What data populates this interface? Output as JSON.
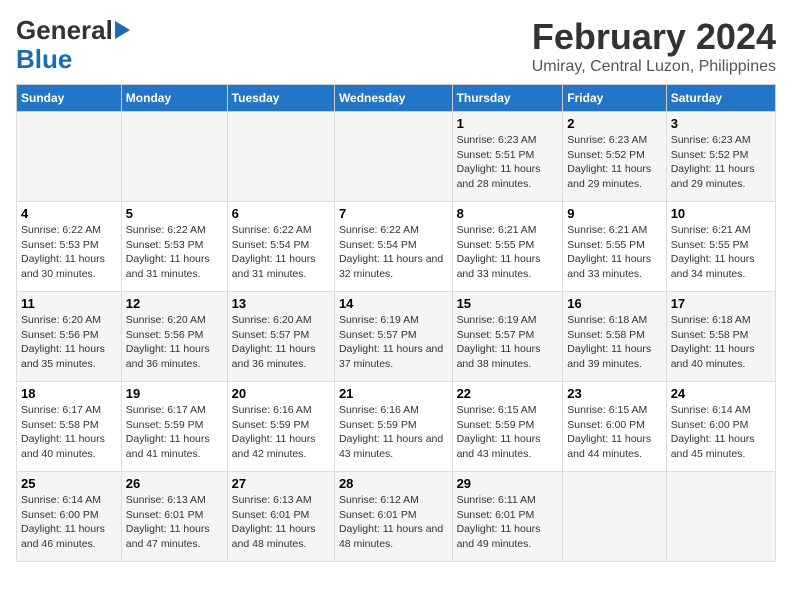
{
  "header": {
    "logo_line1": "General",
    "logo_line2": "Blue",
    "title": "February 2024",
    "subtitle": "Umiray, Central Luzon, Philippines"
  },
  "calendar": {
    "days_of_week": [
      "Sunday",
      "Monday",
      "Tuesday",
      "Wednesday",
      "Thursday",
      "Friday",
      "Saturday"
    ],
    "weeks": [
      [
        {
          "day": "",
          "info": ""
        },
        {
          "day": "",
          "info": ""
        },
        {
          "day": "",
          "info": ""
        },
        {
          "day": "",
          "info": ""
        },
        {
          "day": "1",
          "info": "Sunrise: 6:23 AM\nSunset: 5:51 PM\nDaylight: 11 hours and 28 minutes."
        },
        {
          "day": "2",
          "info": "Sunrise: 6:23 AM\nSunset: 5:52 PM\nDaylight: 11 hours and 29 minutes."
        },
        {
          "day": "3",
          "info": "Sunrise: 6:23 AM\nSunset: 5:52 PM\nDaylight: 11 hours and 29 minutes."
        }
      ],
      [
        {
          "day": "4",
          "info": "Sunrise: 6:22 AM\nSunset: 5:53 PM\nDaylight: 11 hours and 30 minutes."
        },
        {
          "day": "5",
          "info": "Sunrise: 6:22 AM\nSunset: 5:53 PM\nDaylight: 11 hours and 31 minutes."
        },
        {
          "day": "6",
          "info": "Sunrise: 6:22 AM\nSunset: 5:54 PM\nDaylight: 11 hours and 31 minutes."
        },
        {
          "day": "7",
          "info": "Sunrise: 6:22 AM\nSunset: 5:54 PM\nDaylight: 11 hours and 32 minutes."
        },
        {
          "day": "8",
          "info": "Sunrise: 6:21 AM\nSunset: 5:55 PM\nDaylight: 11 hours and 33 minutes."
        },
        {
          "day": "9",
          "info": "Sunrise: 6:21 AM\nSunset: 5:55 PM\nDaylight: 11 hours and 33 minutes."
        },
        {
          "day": "10",
          "info": "Sunrise: 6:21 AM\nSunset: 5:55 PM\nDaylight: 11 hours and 34 minutes."
        }
      ],
      [
        {
          "day": "11",
          "info": "Sunrise: 6:20 AM\nSunset: 5:56 PM\nDaylight: 11 hours and 35 minutes."
        },
        {
          "day": "12",
          "info": "Sunrise: 6:20 AM\nSunset: 5:56 PM\nDaylight: 11 hours and 36 minutes."
        },
        {
          "day": "13",
          "info": "Sunrise: 6:20 AM\nSunset: 5:57 PM\nDaylight: 11 hours and 36 minutes."
        },
        {
          "day": "14",
          "info": "Sunrise: 6:19 AM\nSunset: 5:57 PM\nDaylight: 11 hours and 37 minutes."
        },
        {
          "day": "15",
          "info": "Sunrise: 6:19 AM\nSunset: 5:57 PM\nDaylight: 11 hours and 38 minutes."
        },
        {
          "day": "16",
          "info": "Sunrise: 6:18 AM\nSunset: 5:58 PM\nDaylight: 11 hours and 39 minutes."
        },
        {
          "day": "17",
          "info": "Sunrise: 6:18 AM\nSunset: 5:58 PM\nDaylight: 11 hours and 40 minutes."
        }
      ],
      [
        {
          "day": "18",
          "info": "Sunrise: 6:17 AM\nSunset: 5:58 PM\nDaylight: 11 hours and 40 minutes."
        },
        {
          "day": "19",
          "info": "Sunrise: 6:17 AM\nSunset: 5:59 PM\nDaylight: 11 hours and 41 minutes."
        },
        {
          "day": "20",
          "info": "Sunrise: 6:16 AM\nSunset: 5:59 PM\nDaylight: 11 hours and 42 minutes."
        },
        {
          "day": "21",
          "info": "Sunrise: 6:16 AM\nSunset: 5:59 PM\nDaylight: 11 hours and 43 minutes."
        },
        {
          "day": "22",
          "info": "Sunrise: 6:15 AM\nSunset: 5:59 PM\nDaylight: 11 hours and 43 minutes."
        },
        {
          "day": "23",
          "info": "Sunrise: 6:15 AM\nSunset: 6:00 PM\nDaylight: 11 hours and 44 minutes."
        },
        {
          "day": "24",
          "info": "Sunrise: 6:14 AM\nSunset: 6:00 PM\nDaylight: 11 hours and 45 minutes."
        }
      ],
      [
        {
          "day": "25",
          "info": "Sunrise: 6:14 AM\nSunset: 6:00 PM\nDaylight: 11 hours and 46 minutes."
        },
        {
          "day": "26",
          "info": "Sunrise: 6:13 AM\nSunset: 6:01 PM\nDaylight: 11 hours and 47 minutes."
        },
        {
          "day": "27",
          "info": "Sunrise: 6:13 AM\nSunset: 6:01 PM\nDaylight: 11 hours and 48 minutes."
        },
        {
          "day": "28",
          "info": "Sunrise: 6:12 AM\nSunset: 6:01 PM\nDaylight: 11 hours and 48 minutes."
        },
        {
          "day": "29",
          "info": "Sunrise: 6:11 AM\nSunset: 6:01 PM\nDaylight: 11 hours and 49 minutes."
        },
        {
          "day": "",
          "info": ""
        },
        {
          "day": "",
          "info": ""
        }
      ]
    ]
  }
}
